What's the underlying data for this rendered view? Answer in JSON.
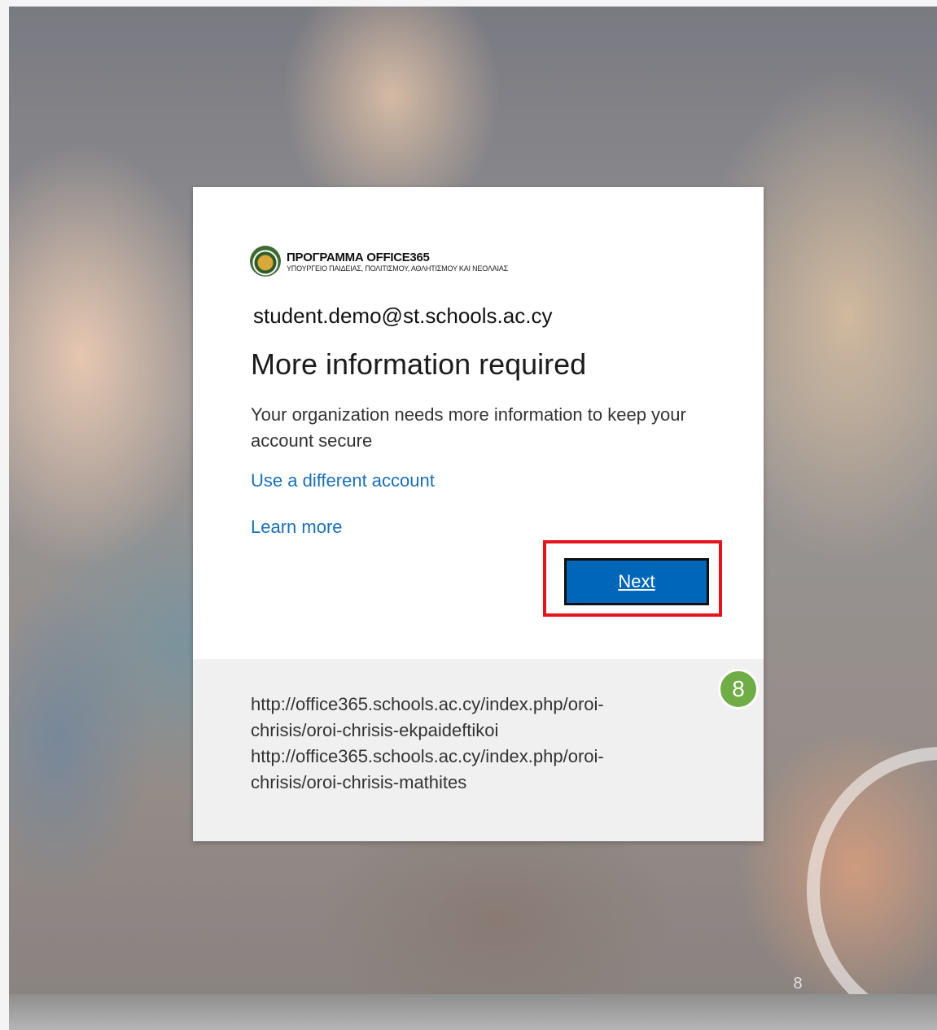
{
  "logo": {
    "title": "ΠΡΟΓΡΑΜΜΑ OFFICE365",
    "subtitle": "ΥΠΟΥΡΓΕΙΟ ΠΑΙΔΕΙΑΣ, ΠΟΛΙΤΙΣΜΟΥ, ΑΘΛΗΤΙΣΜΟΥ ΚΑΙ ΝΕΟΛΑΙΑΣ"
  },
  "account": {
    "email": "student.demo@st.schools.ac.cy"
  },
  "dialog": {
    "title": "More information required",
    "description": "Your organization needs more information to keep your account secure",
    "links": {
      "use_different_account": "Use a different account",
      "learn_more": "Learn more"
    },
    "next_label": "Next"
  },
  "footer": {
    "url_1": "http://office365.schools.ac.cy/index.php/oroi-chrisis/oroi-chrisis-ekpaideftikoi",
    "url_2": "http://office365.schools.ac.cy/index.php/oroi-chrisis/oroi-chrisis-mathites"
  },
  "annotation": {
    "step_number": "8",
    "badge_color": "#70ad47",
    "highlight_color": "#e5141a"
  },
  "slide": {
    "page_number": "8"
  },
  "colors": {
    "accent": "#0067b8",
    "link": "#1a6fb5"
  }
}
